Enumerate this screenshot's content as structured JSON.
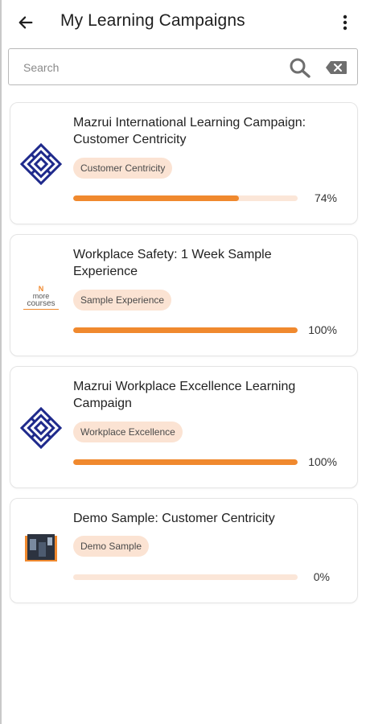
{
  "header": {
    "title": "My Learning Campaigns",
    "back_icon": "arrow-left-icon",
    "menu_icon": "more-vertical-icon"
  },
  "search": {
    "placeholder": "Search",
    "value": "",
    "search_icon": "search-icon",
    "clear_icon": "backspace-icon"
  },
  "colors": {
    "accent": "#f0892e",
    "track": "#fbe6d8",
    "tag_bg": "#fbe3d3",
    "logo_blue": "#1f2a8c"
  },
  "campaigns": [
    {
      "title": "Mazrui International Learning Campaign: Customer Centricity",
      "tag": "Customer Centricity",
      "progress": 74,
      "progress_label": "74%",
      "thumbnail": "mazrui-maze-logo"
    },
    {
      "title": "Workplace Safety: 1 Week Sample Experience",
      "tag": "Sample Experience",
      "progress": 100,
      "progress_label": "100%",
      "thumbnail": "more-courses-logo",
      "logo_text": [
        "N",
        "more",
        "courses"
      ]
    },
    {
      "title": "Mazrui Workplace Excellence Learning Campaign",
      "tag": "Workplace Excellence",
      "progress": 100,
      "progress_label": "100%",
      "thumbnail": "mazrui-maze-logo"
    },
    {
      "title": "Demo Sample: Customer Centricity",
      "tag": "Demo Sample",
      "progress": 0,
      "progress_label": "0%",
      "thumbnail": "demo-photo"
    }
  ]
}
